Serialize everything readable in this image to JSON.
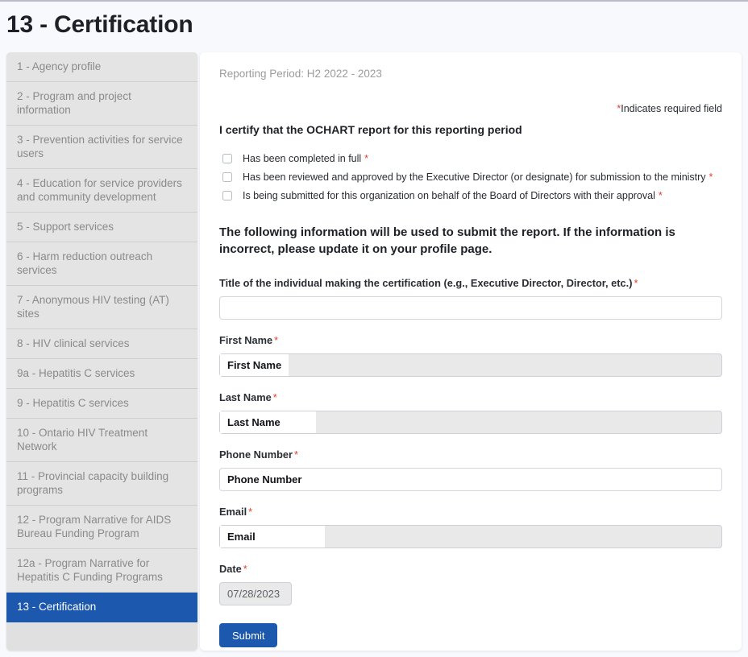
{
  "page": {
    "title": "13 - Certification"
  },
  "sidebar": {
    "items": [
      {
        "label": "1 - Agency profile",
        "active": false
      },
      {
        "label": "2 - Program and project information",
        "active": false
      },
      {
        "label": "3 - Prevention activities for service users",
        "active": false
      },
      {
        "label": "4 - Education for service providers and community development",
        "active": false
      },
      {
        "label": "5 - Support services",
        "active": false
      },
      {
        "label": "6 - Harm reduction outreach services",
        "active": false
      },
      {
        "label": "7 - Anonymous HIV testing (AT) sites",
        "active": false
      },
      {
        "label": "8 - HIV clinical services",
        "active": false
      },
      {
        "label": "9a - Hepatitis C services",
        "active": false
      },
      {
        "label": "9 - Hepatitis C services",
        "active": false
      },
      {
        "label": "10 - Ontario HIV Treatment Network",
        "active": false
      },
      {
        "label": "11 - Provincial capacity building programs",
        "active": false
      },
      {
        "label": "12 - Program Narrative for AIDS Bureau Funding Program",
        "active": false
      },
      {
        "label": "12a - Program Narrative for Hepatitis C Funding Programs",
        "active": false
      },
      {
        "label": "13 - Certification",
        "active": true
      }
    ]
  },
  "main": {
    "reporting_period": "Reporting Period: H2 2022 - 2023",
    "required_note_star": "*",
    "required_note_text": "Indicates required field",
    "certify_heading": "I certify that the OCHART report for this reporting period",
    "checkboxes": [
      {
        "label": "Has been completed in full",
        "required": "*",
        "checked": false
      },
      {
        "label": "Has been reviewed and approved by the Executive Director (or designate) for submission to the ministry",
        "required": "*",
        "checked": false
      },
      {
        "label": "Is being submitted for this organization on behalf of the Board of Directors with their approval",
        "required": "*",
        "checked": false
      }
    ],
    "info_paragraph": "The following information will be used to submit the report. If the information is incorrect, please update it on your profile page.",
    "fields": {
      "title_of_individual": {
        "label": "Title of the individual making the certification (e.g., Executive Director, Director, etc.)",
        "required": "*",
        "value": "",
        "placeholder": ""
      },
      "first_name": {
        "label": "First Name",
        "required": "*",
        "value": "First Name"
      },
      "last_name": {
        "label": "Last Name",
        "required": "*",
        "value": "Last Name"
      },
      "phone_number": {
        "label": "Phone Number",
        "required": "*",
        "value": "Phone Number"
      },
      "email": {
        "label": "Email",
        "required": "*",
        "value": "Email"
      },
      "date": {
        "label": "Date",
        "required": "*",
        "value": "07/28/2023"
      }
    },
    "submit_label": "Submit"
  },
  "colors": {
    "accent_blue": "#1b58ae",
    "required_red": "#e8392c",
    "sidebar_grey": "#e0e0e0",
    "page_bg": "#f8f9fd"
  }
}
